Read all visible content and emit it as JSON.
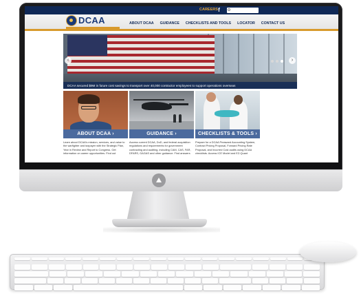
{
  "topbar": {
    "careers_label": "CAREERS",
    "facebook_label": "f",
    "search_placeholder": ""
  },
  "header": {
    "logo_text": "DCAA",
    "nav": [
      "ABOUT DCAA",
      "GUIDANCE",
      "CHECKLISTS AND TOOLS",
      "LOCATOR",
      "CONTACT US"
    ]
  },
  "hero": {
    "caption": "DCAA secured $9M in future cost savings to transport over 40,000 contractor employees to support operations overseas",
    "prev_arrow": "‹",
    "next_arrow": "›",
    "slide_count": 3,
    "active_slide": 3
  },
  "cards": [
    {
      "title": "ABOUT DCAA ›",
      "text": "Learn about DCAA's mission, services, and value to the warfighter and taxpayer with the Strategic Plan, Year in Review and Report to Congress. Get information on career opportunities. Find out"
    },
    {
      "title": "GUIDANCE ›",
      "text": "Access current DCAA, DoD, and federal acquisition regulations and requirements for government contracting and auditing, including CAM, CAS, FAR, DFARS, GAGAS and other guidance. Find answers"
    },
    {
      "title": "CHECKLISTS & TOOLS ›",
      "text": "Prepare for a DCAA Preaward Accounting System, Contract Pricing Proposal, Forward Pricing Rate Proposal, and Incurred Cost audits using DCAA checklists. Access ICE Model and EZ-Quant"
    }
  ],
  "colors": {
    "navy": "#0f2856",
    "gold": "#d89a2c",
    "card_band": "#4b6a9e"
  }
}
